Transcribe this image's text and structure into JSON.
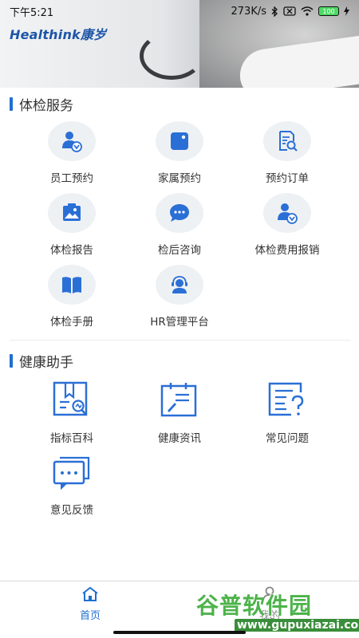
{
  "status_bar": {
    "time": "下午5:21",
    "network_speed": "273K/s",
    "battery": "100"
  },
  "brand": {
    "logo_text": "Healthink康岁"
  },
  "sections": {
    "exam": {
      "title": "体检服务",
      "items": [
        {
          "label": "员工预约",
          "icon": "employee-badge-icon"
        },
        {
          "label": "家属预约",
          "icon": "family-card-icon"
        },
        {
          "label": "预约订单",
          "icon": "order-search-icon"
        },
        {
          "label": "体检报告",
          "icon": "report-image-icon"
        },
        {
          "label": "检后咨询",
          "icon": "chat-bubble-icon"
        },
        {
          "label": "体检费用报销",
          "icon": "reimburse-user-icon"
        },
        {
          "label": "体检手册",
          "icon": "book-icon"
        },
        {
          "label": "HR管理平台",
          "icon": "hr-headset-icon"
        }
      ]
    },
    "health": {
      "title": "健康助手",
      "items": [
        {
          "label": "指标百科",
          "icon": "indicator-wiki-icon"
        },
        {
          "label": "健康资讯",
          "icon": "health-news-icon"
        },
        {
          "label": "常见问题",
          "icon": "faq-icon"
        },
        {
          "label": "意见反馈",
          "icon": "feedback-chat-icon"
        }
      ]
    }
  },
  "bottom_nav": {
    "home_label": "首页",
    "mine_label": "我的"
  },
  "watermark": {
    "title": "谷普软件园",
    "url": "www.gupuxiazai.com"
  },
  "colors": {
    "accent": "#1f6fd1",
    "icon_blue": "#2a6fd6",
    "icon_bg": "#eef1f4"
  }
}
